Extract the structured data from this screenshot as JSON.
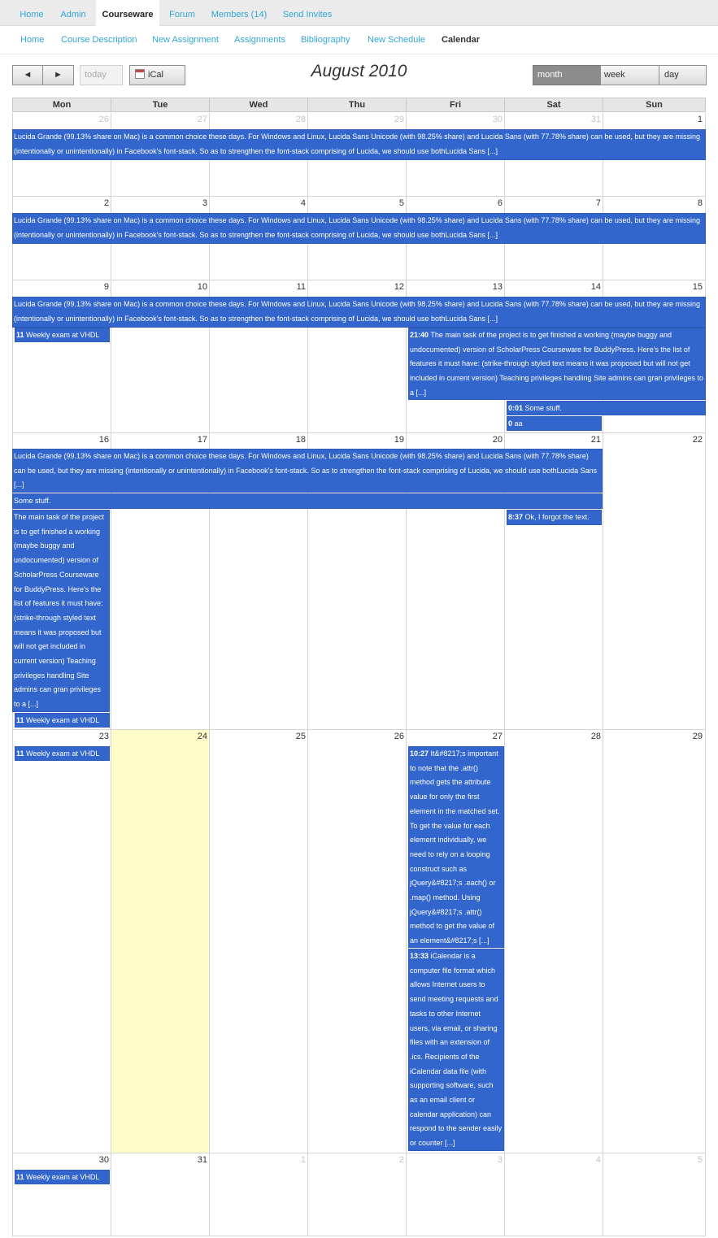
{
  "nav": {
    "tabs": [
      "Home",
      "Admin",
      "Courseware",
      "Forum",
      "Members (14)",
      "Send Invites"
    ],
    "subnav": [
      "Home",
      "Course Description",
      "New Assignment",
      "Assignments",
      "Bibliography",
      "New Schedule",
      "Calendar"
    ]
  },
  "toolbar": {
    "prev": "◄",
    "next": "►",
    "today": "today",
    "ical": "iCal",
    "title": "August 2010",
    "views": [
      "month",
      "week",
      "day"
    ]
  },
  "calendar": {
    "weekday_headers": [
      "Mon",
      "Tue",
      "Wed",
      "Thu",
      "Fri",
      "Sat",
      "Sun"
    ],
    "weeks": [
      [
        "26",
        "27",
        "28",
        "29",
        "30",
        "31",
        "1"
      ],
      [
        "2",
        "3",
        "4",
        "5",
        "6",
        "7",
        "8"
      ],
      [
        "9",
        "10",
        "11",
        "12",
        "13",
        "14",
        "15"
      ],
      [
        "16",
        "17",
        "18",
        "19",
        "20",
        "21",
        "22"
      ],
      [
        "23",
        "24",
        "25",
        "26",
        "27",
        "28",
        "29"
      ],
      [
        "30",
        "31",
        "1",
        "2",
        "3",
        "4",
        "5"
      ]
    ]
  },
  "events": {
    "lucida_text": " Lucida Grande (99.13% share on Mac) is a common choice these days. For Windows and Linux, Lucida Sans Unicode (with 98.25% share) and Lucida Sans (with 77.78% share) can be used, but they are missing (intentionally or unintentionally) in Facebook's font-stack. So as to strengthen the font-stack comprising of Lucida, we should use bothLucida Sans [...]",
    "lucida_text_w4": " Lucida Grande (99.13% share on Mac) is a common choice these days. For Windows and Linux, Lucida Sans Unicode (with 98.25% share) and Lucida Sans (with 77.78% share) can be used, but they are missing (intentionally or unintentionally) in Facebook's font-stack. So as to strengthen the font-stack comprising of Lucida, we should use bothLucida Sans [...]",
    "exam_time": "11",
    "exam_title": "Weekly exam at VHDL",
    "task_time": "21:40",
    "task_text": "The main task of the project is to get finished a working (maybe buggy and undocumented) version of ScholarPress Courseware for BuddyPress. Here's the list of features it must have: (strike-through styled text means it was proposed but will not get included in current version) Teaching privileges handling Site admins can gran privileges to a [...]",
    "some_time": "0:01",
    "some_text": "Some stuff.",
    "aa_time": "0",
    "aa_text": "aa",
    "some_stuff_w4": "Some stuff.",
    "task_text_w4": "The main task of the project is to get finished a working (maybe buggy and undocumented) version of ScholarPress Courseware for BuddyPress. Here's the list of features it must have: (strike-through styled text means it was proposed but will not get included in current version) Teaching privileges handling Site admins can gran privileges to a [...]",
    "forgot_time": "8:37",
    "forgot_text": "Ok, I forgot the text.",
    "attr_time": "10:27",
    "attr_text": "It&#8217;s important to note that the .attr() method gets the attribute value for only the first element in the matched set. To get the value for each element individually, we need to rely on a looping construct such as jQuery&#8217;s .each() or .map() method. Using jQuery&#8217;s .attr() method to get the value of an element&#8217;s [...]",
    "ical_time": "13:33",
    "ical_text": "iCalendar is a computer file format which allows Internet users to send meeting requests and tasks to other Internet users, via email, or sharing files with an extension of .ics. Recipients of the iCalendar data file (with supporting software, such as an email client or calendar application) can respond to the sender easily or counter [...]"
  },
  "colors": {
    "event_bg": "#3366cc",
    "today_bg": "#fffcc8",
    "link": "#31a6d3"
  }
}
